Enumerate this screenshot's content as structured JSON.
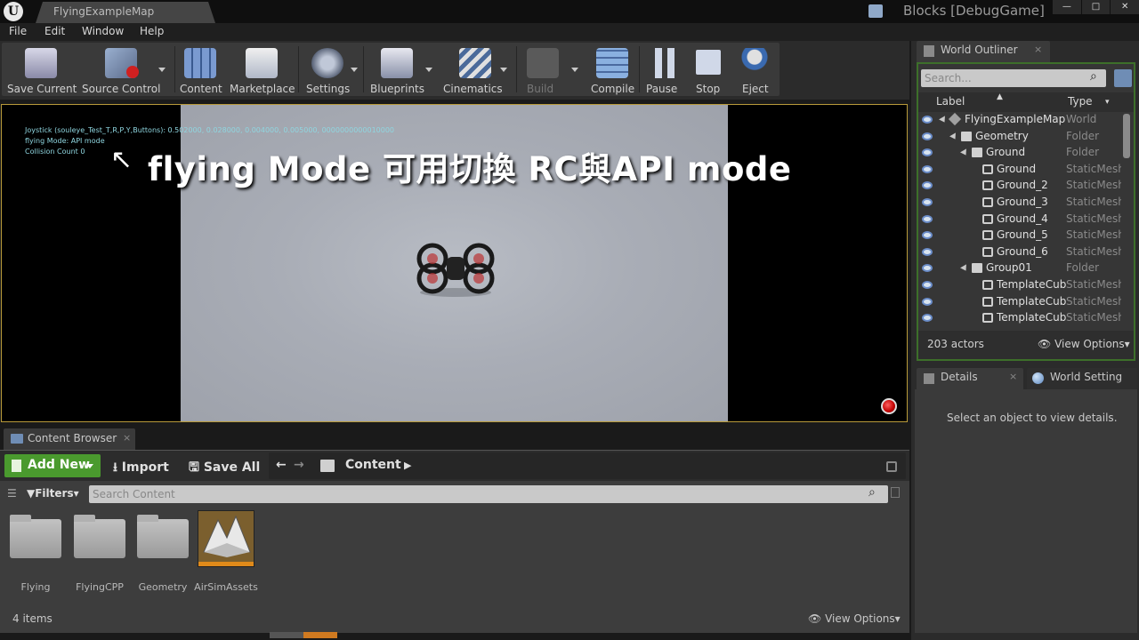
{
  "window": {
    "map_tab": "FlyingExampleMap",
    "project": "Blocks [DebugGame]",
    "controls": [
      "—",
      "□",
      "✕"
    ]
  },
  "menu": [
    "File",
    "Edit",
    "Window",
    "Help"
  ],
  "toolbar": {
    "save_current": "Save Current",
    "source_control": "Source Control",
    "content": "Content",
    "marketplace": "Marketplace",
    "settings": "Settings",
    "blueprints": "Blueprints",
    "cinematics": "Cinematics",
    "build": "Build",
    "compile": "Compile",
    "pause": "Pause",
    "stop": "Stop",
    "eject": "Eject"
  },
  "viewport": {
    "debug_line1": "Joystick (souleye_Test_T,R,P,Y,Buttons): 0.502000, 0.028000, 0.004000, 0.005000, 0000000000010000",
    "debug_line2": "flying Mode: API mode",
    "debug_line3": "Collision Count 0",
    "annotation_arrow": "↖",
    "annotation_text": "flying Mode 可用切換 RC與API mode"
  },
  "content_browser": {
    "tab_label": "Content Browser",
    "tab_close": "×",
    "add_new": "Add New",
    "import": "Import",
    "save_all": "Save All",
    "path_root": "Content",
    "filters": "Filters",
    "search_placeholder": "Search Content",
    "items": [
      {
        "name": "Flying",
        "kind": "folder"
      },
      {
        "name": "FlyingCPP",
        "kind": "folder"
      },
      {
        "name": "Geometry",
        "kind": "folder"
      },
      {
        "name": "AirSimAssets",
        "kind": "asset"
      }
    ],
    "item_count": "4 items",
    "view_options": "View Options"
  },
  "world_outliner": {
    "tab_label": "World Outliner",
    "tab_close": "×",
    "search_placeholder": "Search...",
    "col_label": "Label",
    "col_type": "Type",
    "rows": [
      {
        "label": "FlyingExampleMap",
        "type": "World",
        "indent": 0,
        "icon": "world-icon"
      },
      {
        "label": "Geometry",
        "type": "Folder",
        "indent": 1,
        "icon": "folder-icon"
      },
      {
        "label": "Ground",
        "type": "Folder",
        "indent": 2,
        "icon": "folder-icon"
      },
      {
        "label": "Ground",
        "type": "StaticMesh",
        "indent": 3,
        "icon": "mesh-icon"
      },
      {
        "label": "Ground_2",
        "type": "StaticMesh",
        "indent": 3,
        "icon": "mesh-icon"
      },
      {
        "label": "Ground_3",
        "type": "StaticMesh",
        "indent": 3,
        "icon": "mesh-icon"
      },
      {
        "label": "Ground_4",
        "type": "StaticMesh",
        "indent": 3,
        "icon": "mesh-icon"
      },
      {
        "label": "Ground_5",
        "type": "StaticMesh",
        "indent": 3,
        "icon": "mesh-icon"
      },
      {
        "label": "Ground_6",
        "type": "StaticMesh",
        "indent": 3,
        "icon": "mesh-icon"
      },
      {
        "label": "Group01",
        "type": "Folder",
        "indent": 2,
        "icon": "folder-icon"
      },
      {
        "label": "TemplateCube",
        "type": "StaticMesh",
        "indent": 3,
        "icon": "mesh-icon"
      },
      {
        "label": "TemplateCube",
        "type": "StaticMesh",
        "indent": 3,
        "icon": "mesh-icon"
      },
      {
        "label": "TemplateCube",
        "type": "StaticMesh",
        "indent": 3,
        "icon": "mesh-icon"
      }
    ],
    "actor_count": "203 actors",
    "view_options": "View Options"
  },
  "details": {
    "tab_label": "Details",
    "tab_close": "×",
    "world_settings_tab": "World Setting",
    "empty_message": "Select an object to view details."
  }
}
